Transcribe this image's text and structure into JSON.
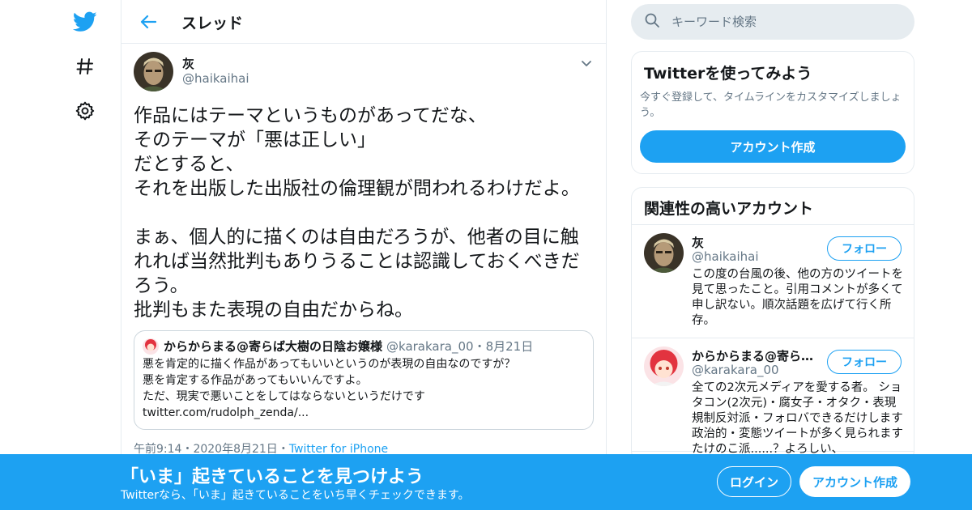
{
  "nav": {
    "icons": [
      "twitter-bird-icon",
      "hashtag-icon",
      "gear-icon"
    ]
  },
  "header": {
    "title": "スレッド"
  },
  "tweet": {
    "author_name": "灰",
    "author_handle": "@haikaihai",
    "text": "作品にはテーマというものがあってだな、\nそのテーマが「悪は正しい」\nだとすると、\nそれを出版した出版社の倫理観が問われるわけだよ。\n\nまぁ、個人的に描くのは自由だろうが、他者の目に触れれば当然批判もありうることは認識しておくべきだろう。\n批判もまた表現の自由だからね。",
    "quote": {
      "name": "からからまる@寄らば大樹の日陰お嬢様",
      "handle": "@karakara_00",
      "separator": "・",
      "date": "8月21日",
      "text": "悪を肯定的に描く作品があってもいいというのが表現の自由なのですが？\n悪を肯定する作品があってもいいんですよ。\nただ、現実で悪いことをしてはならないというだけです\ntwitter.com/rudolph_zenda/..."
    },
    "time": "午前9:14",
    "sep1": "・",
    "date": "2020年8月21日",
    "sep2": "・",
    "source": "Twitter for iPhone"
  },
  "search": {
    "placeholder": "キーワード検索"
  },
  "signup_card": {
    "title": "Twitterを使ってみよう",
    "subtitle": "今すぐ登録して、タイムラインをカスタマイズしましょう。",
    "button": "アカウント作成"
  },
  "related": {
    "title": "関連性の高いアカウント",
    "follow_label": "フォロー",
    "accounts": [
      {
        "name": "灰",
        "handle": "@haikaihai",
        "bio": "この度の台風の後、他の方のツイートを見て思ったこと。引用コメントが多くて申し訳ない。順次話題を広げて行く所存。"
      },
      {
        "name": "からからまる@寄らば大樹の日陰お嬢様",
        "handle": "@karakara_00",
        "bio": "全ての2次元メディアを愛する者。 ショタコン(2次元)・腐女子・オタク・表現規制反対派・フォロバできるだけします 政治的・変態ツイートが多く見られます たけのこ派......？よろしい、"
      }
    ]
  },
  "banner": {
    "title": "「いま」起きていることを見つけよう",
    "subtitle": "Twitterなら、「いま」起きていることをいち早くチェックできます。",
    "login": "ログイン",
    "signup": "アカウント作成"
  },
  "colors": {
    "accent": "#1da1f2",
    "muted": "#657786",
    "border": "#e6ecf0"
  }
}
